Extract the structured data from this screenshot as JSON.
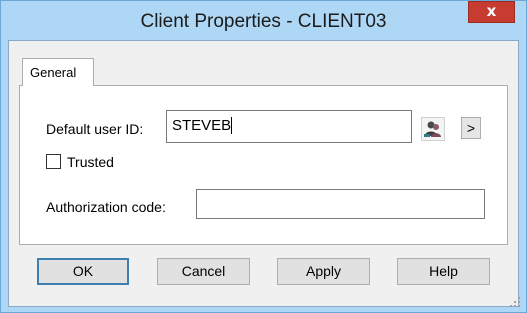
{
  "window": {
    "title": "Client Properties - CLIENT03",
    "close_label": "x"
  },
  "tabs": [
    {
      "label": "General",
      "selected": true
    }
  ],
  "general": {
    "default_user_label": "Default user ID:",
    "default_user_value": "STEVEB",
    "browse_users_icon": "users-icon",
    "more_label": ">",
    "trusted_label": "Trusted",
    "trusted_checked": false,
    "auth_code_label": "Authorization code:",
    "auth_code_value": ""
  },
  "buttons": {
    "ok": "OK",
    "cancel": "Cancel",
    "apply": "Apply",
    "help": "Help"
  },
  "colors": {
    "frame": "#aed7f5",
    "close": "#c73c30",
    "default_button_border": "#3c7fb1"
  }
}
